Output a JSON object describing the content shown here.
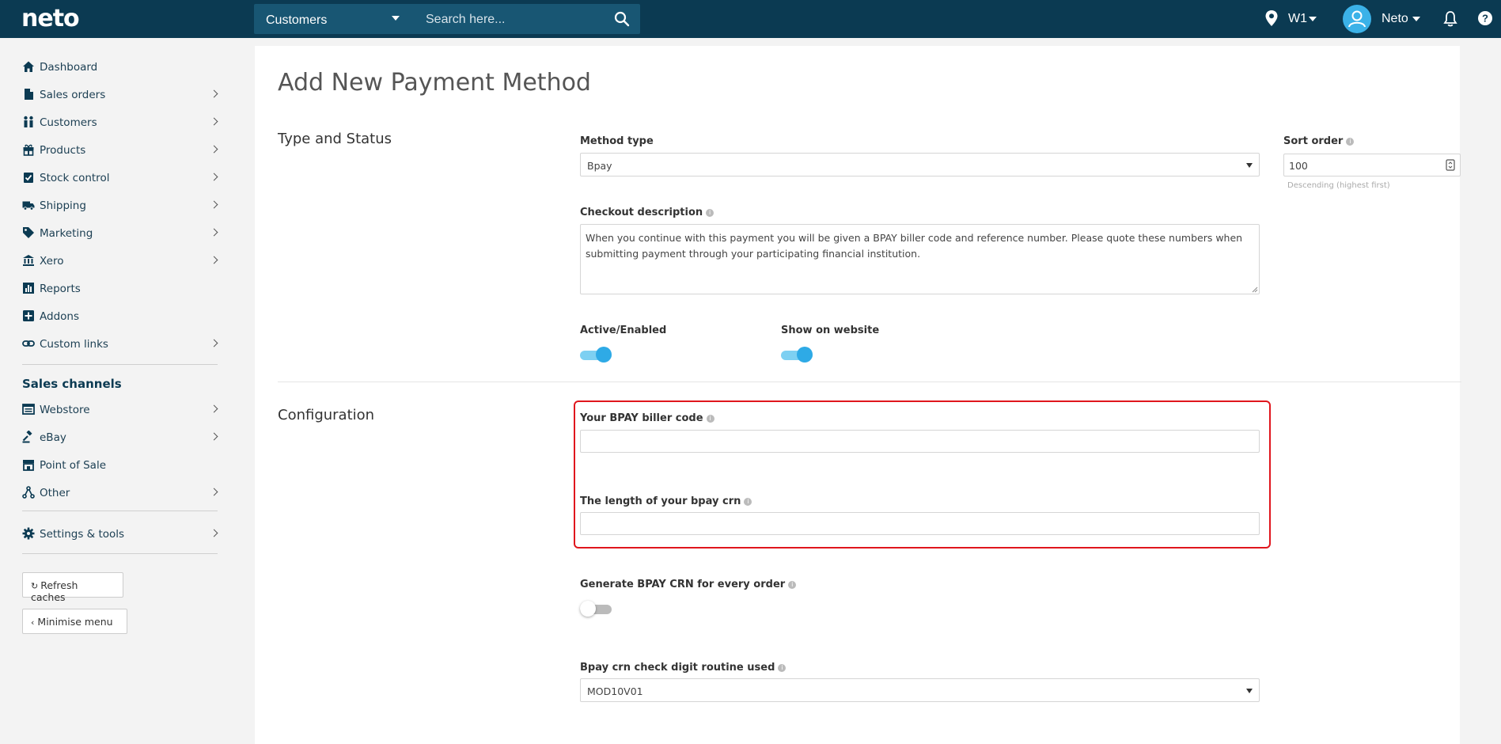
{
  "topbar": {
    "logo": "neto",
    "search_scope": "Customers",
    "search_placeholder": "Search here...",
    "location": "W1",
    "user": "Neto"
  },
  "sidebar": {
    "items": [
      {
        "label": "Dashboard",
        "icon": "home-icon"
      },
      {
        "label": "Sales orders",
        "icon": "document-icon"
      },
      {
        "label": "Customers",
        "icon": "people-icon"
      },
      {
        "label": "Products",
        "icon": "gift-icon"
      },
      {
        "label": "Stock control",
        "icon": "clipboard-check-icon"
      },
      {
        "label": "Shipping",
        "icon": "truck-icon"
      },
      {
        "label": "Marketing",
        "icon": "tag-icon"
      },
      {
        "label": "Xero",
        "icon": "bank-icon"
      },
      {
        "label": "Reports",
        "icon": "bar-chart-icon"
      },
      {
        "label": "Addons",
        "icon": "plus-square-icon"
      },
      {
        "label": "Custom links",
        "icon": "link-icon"
      }
    ],
    "channels_title": "Sales channels",
    "channels": [
      {
        "label": "Webstore",
        "icon": "window-icon"
      },
      {
        "label": "eBay",
        "icon": "gavel-icon"
      },
      {
        "label": "Point of Sale",
        "icon": "store-icon"
      },
      {
        "label": "Other",
        "icon": "share-icon"
      }
    ],
    "settings": {
      "label": "Settings & tools",
      "icon": "gear-icon"
    },
    "refresh_label": "Refresh caches",
    "minimise_label": "Minimise menu"
  },
  "page": {
    "title": "Add New Payment Method",
    "type_status": {
      "heading": "Type and Status",
      "method_type_label": "Method type",
      "method_type_value": "Bpay",
      "sort_order_label": "Sort order",
      "sort_order_value": "100",
      "sort_order_help": "Descending (highest first)",
      "checkout_desc_label": "Checkout description",
      "checkout_desc_value": "When you continue with this payment you will be given a BPAY biller code and reference number. Please quote these numbers when submitting payment through your participating financial institution.",
      "active_label": "Active/Enabled",
      "active": true,
      "show_label": "Show on website",
      "show": true
    },
    "configuration": {
      "heading": "Configuration",
      "biller_code_label": "Your BPAY biller code",
      "biller_code_value": "",
      "crn_length_label": "The length of your bpay crn",
      "crn_length_value": "",
      "generate_crn_label": "Generate BPAY CRN for every order",
      "generate_crn": false,
      "check_digit_label": "Bpay crn check digit routine used",
      "check_digit_value": "MOD10V01"
    }
  },
  "colors": {
    "topbar": "#0b3a52",
    "search_bg": "#185673",
    "accent": "#2eaae6",
    "highlight": "#e0161d"
  }
}
